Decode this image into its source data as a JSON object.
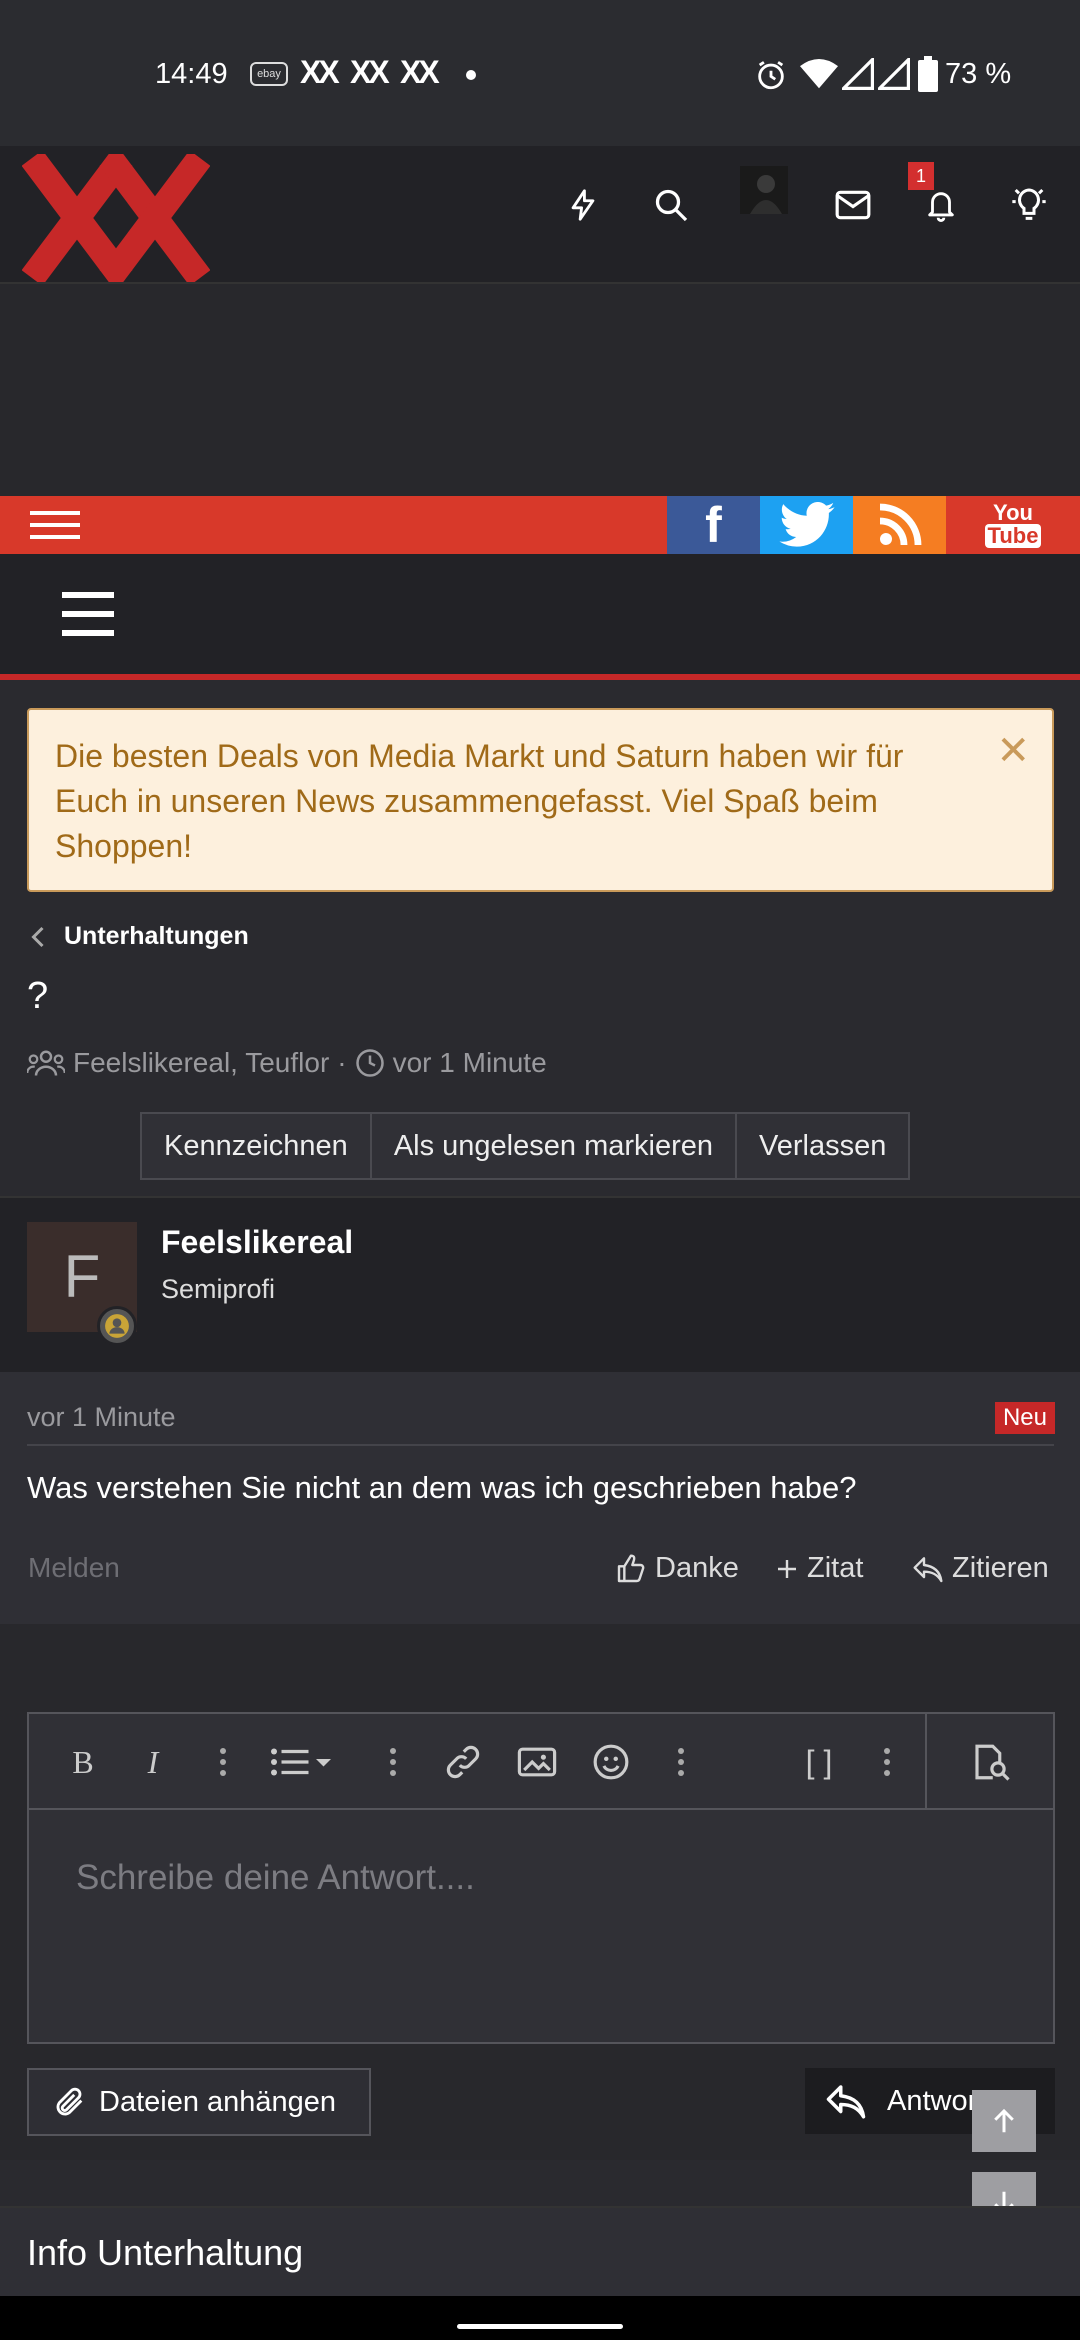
{
  "status_bar": {
    "time": "14:49",
    "ebay": "ebay",
    "xx_labels": [
      "XX",
      "XX",
      "XX"
    ],
    "battery": "73 %"
  },
  "header": {
    "notification_count": "1",
    "logo_alt": "XX"
  },
  "social": {
    "facebook": "f",
    "youtube_top": "You",
    "youtube_bottom": "Tube"
  },
  "notice": {
    "text": "Die besten Deals von Media Markt und Saturn haben wir für Euch in unseren News zusammengefasst. Viel Spaß beim Shoppen!",
    "close": "✕"
  },
  "breadcrumb": {
    "label": "Unterhaltungen"
  },
  "conversation": {
    "title": "?",
    "participants": "Feelslikereal, Teuflor",
    "separator": "·",
    "time": "vor 1 Minute"
  },
  "buttons": {
    "mark": "Kennzeichnen",
    "unread": "Als ungelesen markieren",
    "leave": "Verlassen"
  },
  "author": {
    "initial": "F",
    "name": "Feelslikereal",
    "role": "Semiprofi"
  },
  "post": {
    "time": "vor 1 Minute",
    "badge": "Neu",
    "text": "Was verstehen Sie nicht an dem was ich geschrieben habe?",
    "report": "Melden",
    "thanks": "Danke",
    "quote_plus": "Zitat",
    "quote": "Zitieren"
  },
  "editor": {
    "placeholder": "Schreibe deine Antwort....",
    "bold": "B",
    "italic": "I",
    "brackets": "[ ]"
  },
  "actions": {
    "attach": "Dateien anhängen",
    "reply": "Antworten"
  },
  "info": {
    "title": "Info Unterhaltung"
  },
  "colors": {
    "accent": "#d8392a",
    "background": "#2a2a2f",
    "notice_bg": "#fdf0dd",
    "notice_text": "#a06a18",
    "facebook": "#3b5998",
    "twitter": "#1da1f2",
    "rss": "#f57d22",
    "youtube": "#d8392a"
  }
}
